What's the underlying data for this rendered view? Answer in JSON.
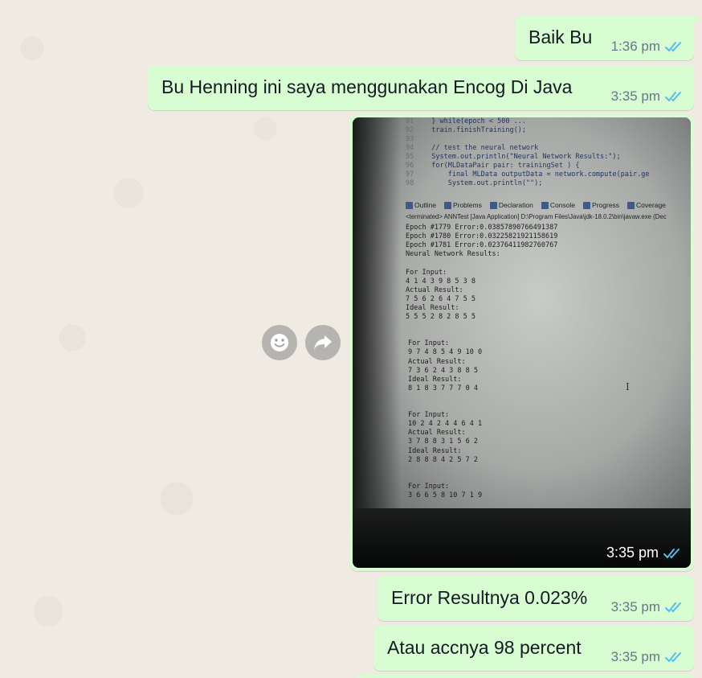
{
  "messages": [
    {
      "text": "Baik Bu",
      "time": "1:36 pm"
    },
    {
      "text": "Bu Henning ini saya menggunakan Encog Di Java",
      "time": "3:35 pm"
    },
    {
      "text": "Error Resultnya 0.023%",
      "time": "3:35 pm"
    },
    {
      "text": "Atau accnya 98 percent",
      "time": "3:35 pm"
    }
  ],
  "image_message": {
    "time": "3:35 pm",
    "photo": {
      "code_lines": [
        {
          "ln": "91",
          "code": "  } while(epoch < 500 ..."
        },
        {
          "ln": "92",
          "code": "  train.finishTraining();"
        },
        {
          "ln": "93",
          "code": ""
        },
        {
          "ln": "94",
          "code": "  // test the neural network"
        },
        {
          "ln": "95",
          "code": "  System.out.println(\"Neural Network Results:\");"
        },
        {
          "ln": "96",
          "code": "  for(MLDataPair pair: trainingSet ) {"
        },
        {
          "ln": "97",
          "code": "      final MLData outputData = network.compute(pair.ge"
        },
        {
          "ln": "98",
          "code": "      System.out.println(\"\");"
        }
      ],
      "tabs": [
        "Outline",
        "Problems",
        "Declaration",
        "Console",
        "Progress",
        "Coverage"
      ],
      "status": "<terminated> ANNTest [Java Application] D:\\Program Files\\Java\\jdk-18.0.2\\bin\\javaw.exe  (Dec",
      "console_lines": [
        "Epoch #1779 Error:0.03857890766491387",
        "Epoch #1780 Error:0.03225821921158619",
        "Epoch #1781 Error:0.02376411982760767",
        "Neural Network Results:",
        "",
        "For Input:",
        "4 1 4 3 9 8 5 3 8",
        "Actual Result:",
        "7 5 6 2 6 4 7 5 5",
        "Ideal Result:",
        "5 5 5 2 8 2 8 5 5",
        "",
        "",
        "For Input:",
        "9 7 4 8 5 4 9 10 0",
        "Actual Result:",
        "7 3 6 2 4 3 8 8 5",
        "Ideal Result:",
        "8 1 8 3 7 7 7 0 4",
        "",
        "",
        "For Input:",
        "10 2 4 2 4 4 6 4 1",
        "Actual Result:",
        "3 7 8 8 3 1 5 6 2",
        "Ideal Result:",
        "2 8 8 8 4 2 5 7 2",
        "",
        "",
        "For Input:",
        "3 6 6 5 8 10 7 1 9"
      ]
    }
  },
  "colors": {
    "bubble_out": "#d9fdd3",
    "read_ticks": "#53bdeb",
    "chat_background": "#efeae2"
  },
  "icons": [
    "emoji-icon",
    "forward-icon",
    "double-check-icon"
  ]
}
